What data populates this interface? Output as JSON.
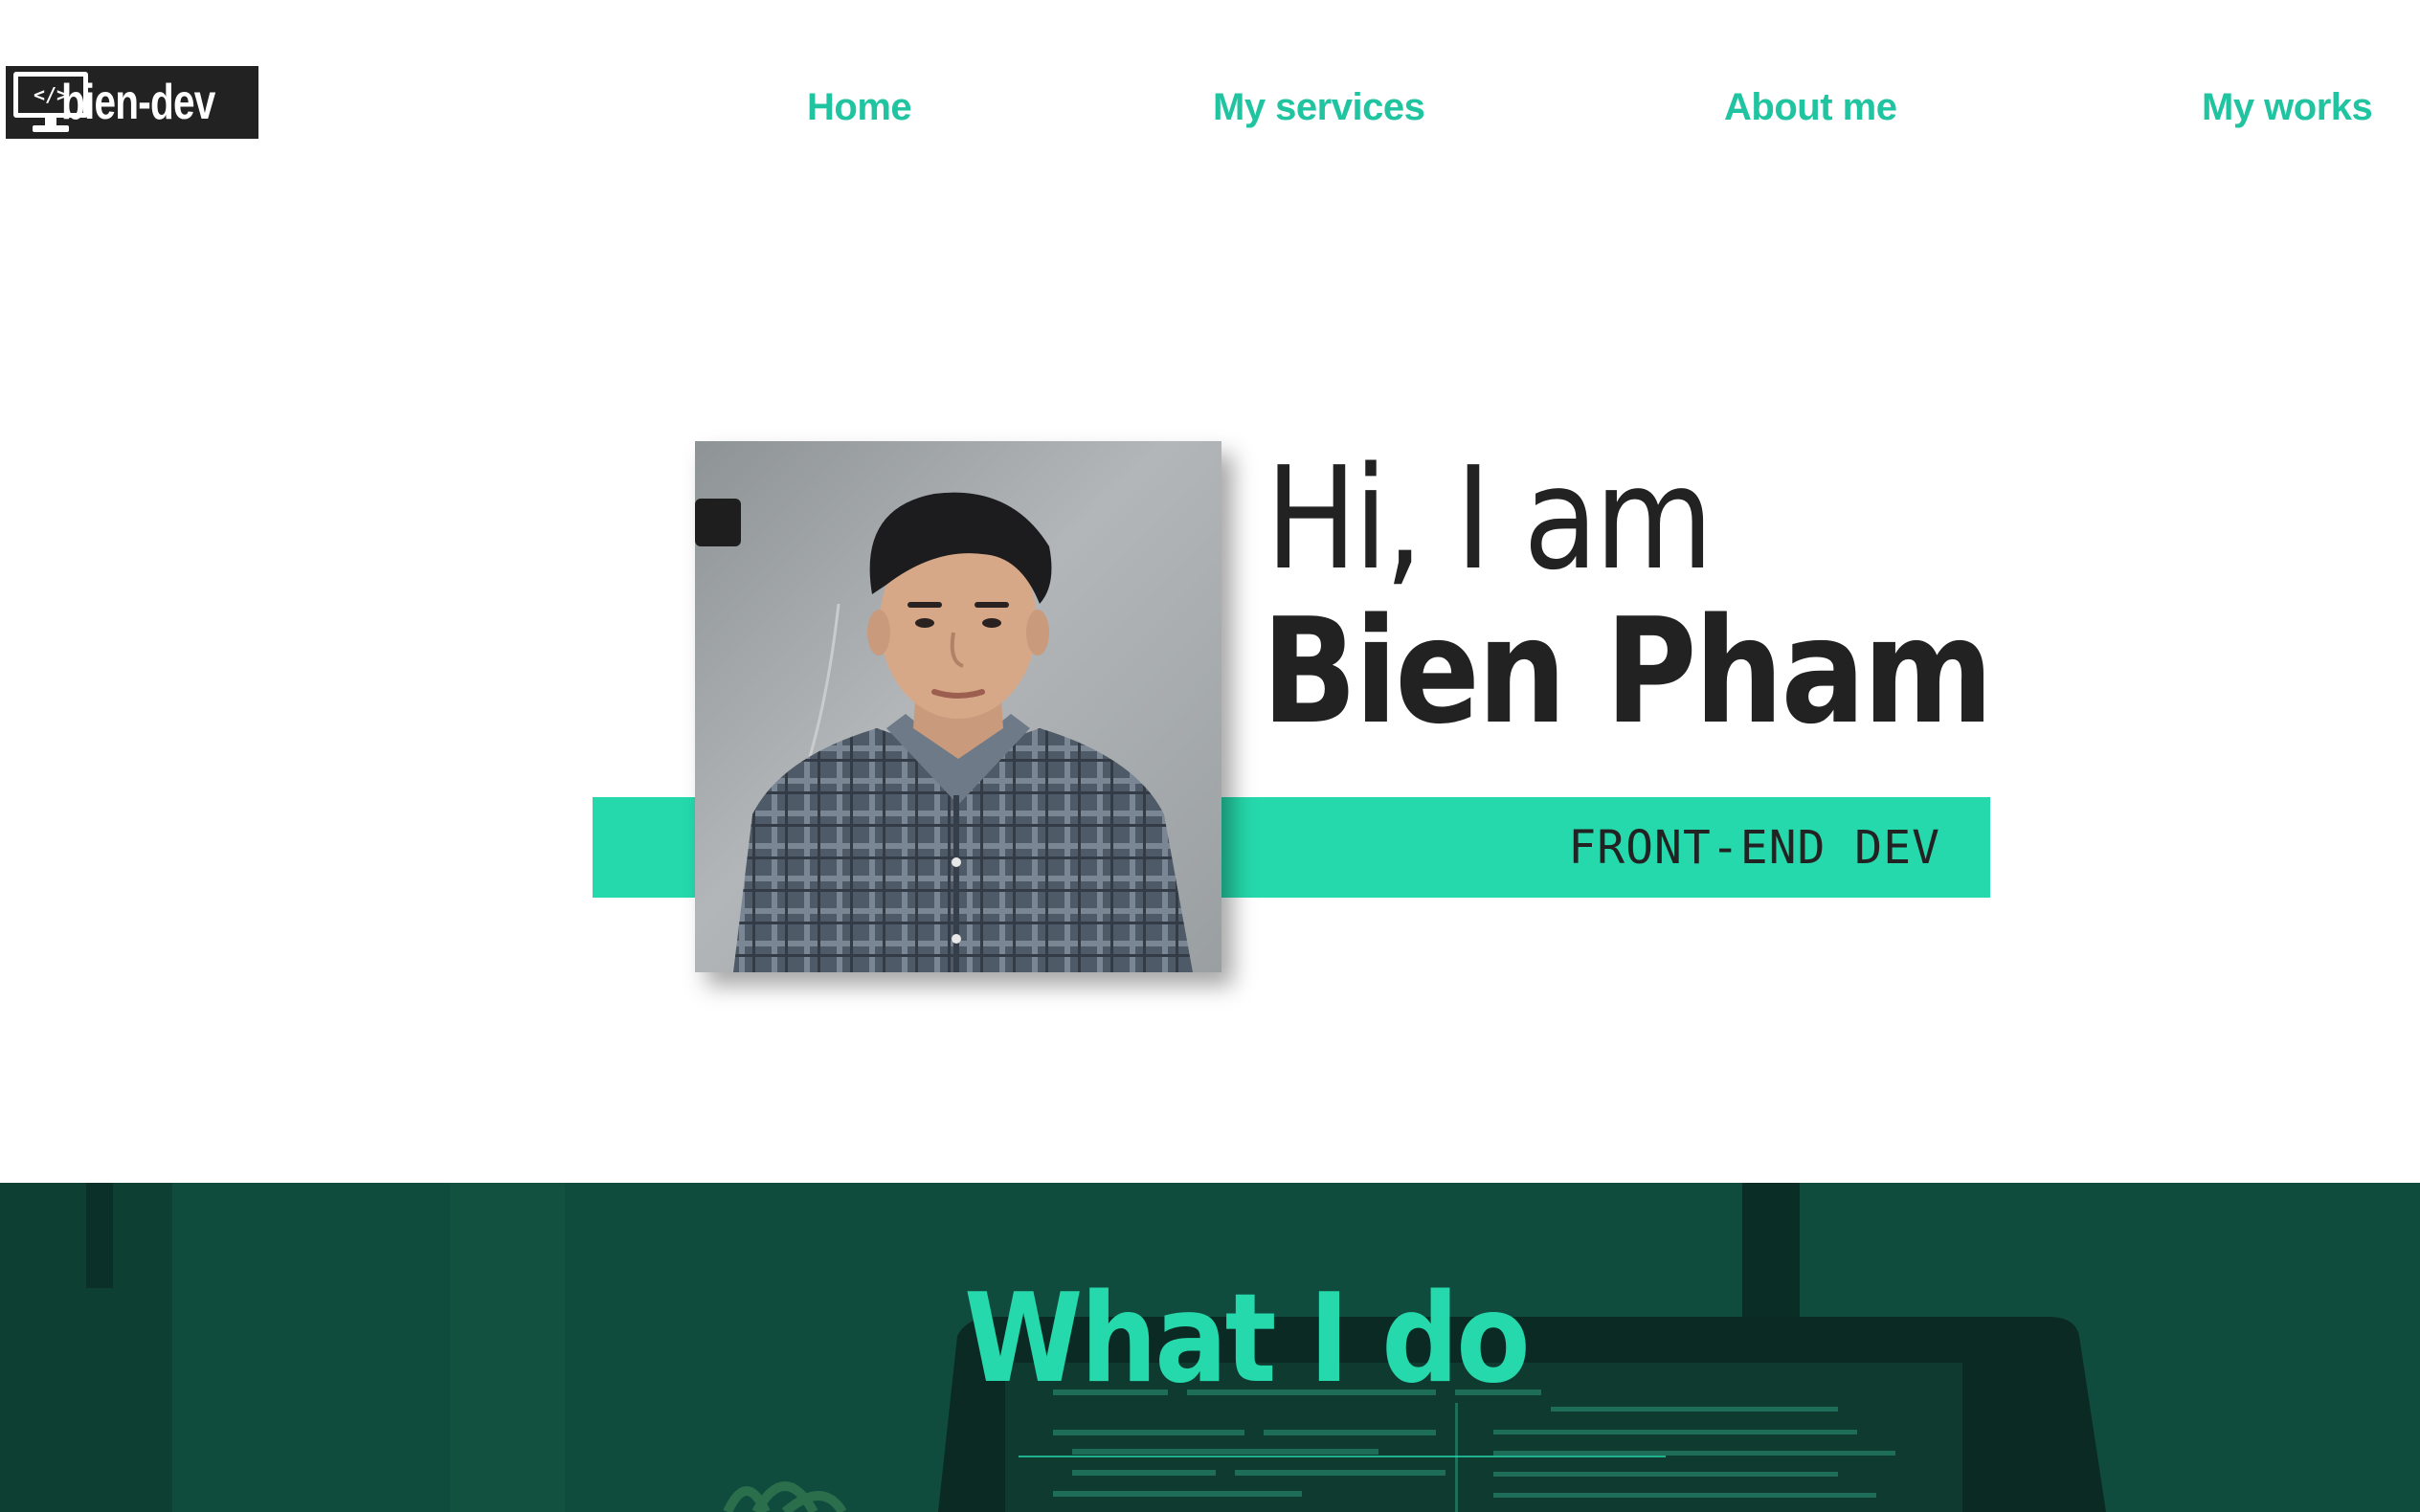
{
  "header": {
    "logo": {
      "icon_text": "</>",
      "text": "bien-dev",
      "icon": "monitor-code-icon"
    },
    "nav": [
      {
        "label": "Home"
      },
      {
        "label": "My services"
      },
      {
        "label": "About me"
      },
      {
        "label": "My works"
      }
    ]
  },
  "hero": {
    "greeting": "Hi, I am",
    "name": "Bien Pham",
    "role": "FRONT-END DEV"
  },
  "services": {
    "title": "What I do"
  },
  "colors": {
    "accent": "#25d9ac",
    "nav_text": "#20c4a0",
    "text_dark": "#222222",
    "services_bg": "#104c3e"
  }
}
